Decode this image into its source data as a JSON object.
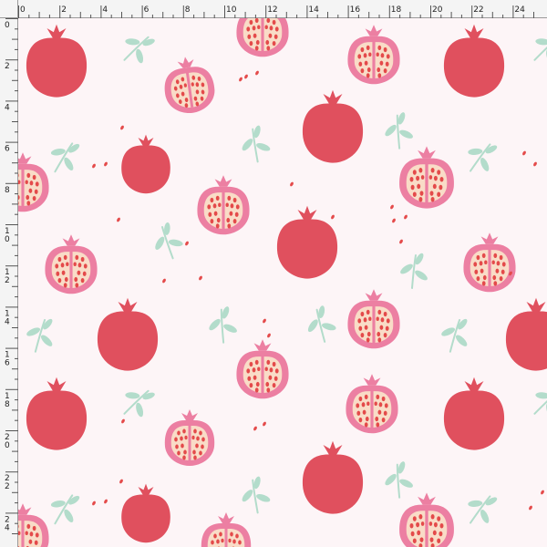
{
  "ruler": {
    "horizontal_labels": [
      "0",
      "2",
      "4",
      "6",
      "8",
      "10",
      "12",
      "14",
      "16",
      "18",
      "20",
      "22",
      "24"
    ],
    "vertical_labels": [
      "0",
      "2",
      "4",
      "6",
      "8",
      "10",
      "12",
      "14",
      "16",
      "18",
      "20",
      "22",
      "24"
    ]
  },
  "pattern": {
    "background_color": "#fdf5f7",
    "colors": {
      "whole_fruit": "#e0505e",
      "cut_fruit_rind": "#ec7fa2",
      "cut_fruit_flesh": "#f9dcc7",
      "seed": "#e44a4a",
      "leaf": "#b3dccb"
    },
    "motifs": [
      "whole-pomegranate",
      "cut-pomegranate",
      "leaf-sprig",
      "scattered-seeds"
    ]
  }
}
